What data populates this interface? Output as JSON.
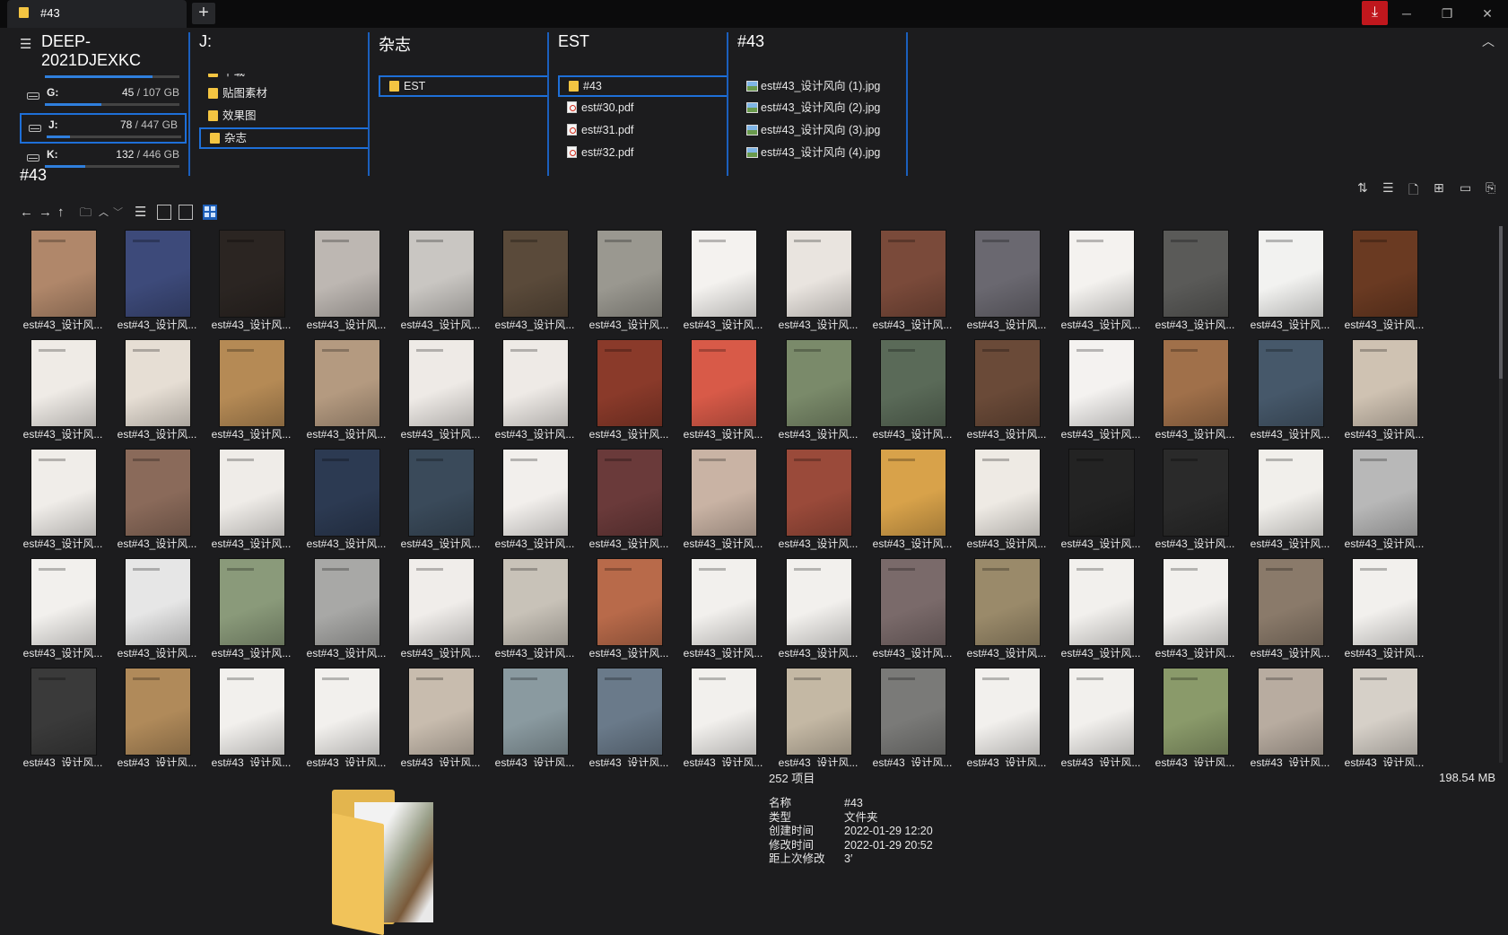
{
  "window": {
    "tab_title": "#43",
    "new_tab": "+",
    "download": "⤓",
    "minimize": "─",
    "restore": "❐",
    "close": "✕"
  },
  "computer": {
    "name": "DEEP-2021DJEXKC",
    "drives": [
      {
        "label": "G:",
        "used": "45",
        "total": " / 107 GB",
        "fraction": 0.42
      },
      {
        "label": "J:",
        "used": "78",
        "total": " / 447 GB",
        "fraction": 0.17
      },
      {
        "label": "K:",
        "used": "132",
        "total": " / 446 GB",
        "fraction": 0.3
      }
    ]
  },
  "columns": {
    "j": {
      "title": "J:",
      "items": [
        "下载",
        "贴图素材",
        "效果图",
        "杂志"
      ]
    },
    "zazhi": {
      "title": "杂志",
      "items": [
        "EST"
      ]
    },
    "est": {
      "title": "EST",
      "items": [
        "#43",
        "est#30.pdf",
        "est#31.pdf",
        "est#32.pdf"
      ]
    },
    "n43": {
      "title": "#43",
      "items": [
        "est#43_设计风向 (1).jpg",
        "est#43_设计风向 (2).jpg",
        "est#43_设计风向 (3).jpg",
        "est#43_设计风向 (4).jpg"
      ]
    }
  },
  "current_path": "#43",
  "thumbnail_caption": "est#43_设计风...",
  "thumbnail_colors": [
    "#b0876a",
    "#3d4a7a",
    "#2b2522",
    "#bdb7b2",
    "#c9c6c2",
    "#5a4a3a",
    "#9a9890",
    "#f4f2ef",
    "#e9e4df",
    "#7a4a3a",
    "#6a6870",
    "#f4f2ef",
    "#5a5a58",
    "#f2f2f0",
    "#6a3a22",
    "#efebe6",
    "#e6ded4",
    "#b58a55",
    "#b49a80",
    "#eeeae6",
    "#eeeae6",
    "#8a3a2a",
    "#d85a48",
    "#7a8a6a",
    "#5a6a58",
    "#6a4a38",
    "#f4f2f0",
    "#a0704a",
    "#46586a",
    "#cfc2b2",
    "#f0ede9",
    "#8a6a5a",
    "#efece8",
    "#2c3a52",
    "#3a4a5a",
    "#f2efec",
    "#6a3a3a",
    "#c9b3a4",
    "#9a4a3a",
    "#d8a24a",
    "#eeeae4",
    "#232323",
    "#2a2a2a",
    "#f1efeb",
    "#b8b8b8",
    "#f2f0ed",
    "#e6e6e6",
    "#8a9a7a",
    "#a8a8a6",
    "#f0edea",
    "#c8c2b8",
    "#b86a4a",
    "#f2f0ed",
    "#f2f0ed",
    "#7a6a6a",
    "#9a8a6a",
    "#f2f0ed",
    "#f2f0ed",
    "#8a7a6a",
    "#f2f0ed",
    "#3a3a3a",
    "#b08a5a",
    "#f2f0ed",
    "#f2f0ed",
    "#c8bcae",
    "#8a9aa0",
    "#6a7a8a",
    "#f2f0ed",
    "#c4b8a4",
    "#7a7a78",
    "#f2f0ed",
    "#f2f0ed",
    "#8a9a6a",
    "#b8aca0",
    "#d6d0c8"
  ],
  "status": {
    "count": "252 项目",
    "total_size": "198.54 MB"
  },
  "info": [
    {
      "key": "名称",
      "value": "#43"
    },
    {
      "key": "类型",
      "value": "文件夹"
    },
    {
      "key": "创建时间",
      "value": "2022-01-29  12:20"
    },
    {
      "key": "修改时间",
      "value": "2022-01-29  20:52"
    },
    {
      "key": "距上次修改",
      "value": "3′"
    }
  ]
}
